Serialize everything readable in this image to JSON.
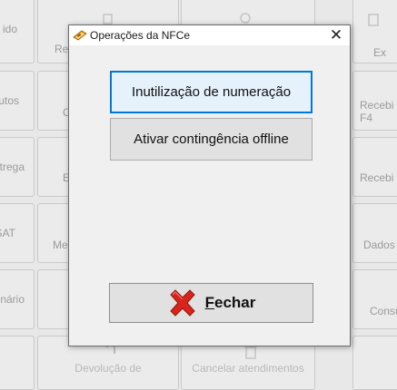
{
  "background": {
    "left_column": [
      "ido",
      "utos",
      "trega",
      "SAT",
      "nário"
    ],
    "col2": [
      "Re",
      "C",
      "E",
      "Me",
      "",
      "Devolução de"
    ],
    "col3": [
      "",
      "",
      "",
      "",
      "",
      "Cancelar atendimentos"
    ],
    "right_column": [
      "Ex",
      "Recebi\nF4",
      "Recebi",
      "Dados",
      "Consu",
      ""
    ]
  },
  "dialog": {
    "title": "Operações da NFCe",
    "close_glyph": "✕",
    "buttons": {
      "inutilizacao": "Inutilização de numeração",
      "contingencia": "Ativar contingência offline",
      "fechar": "Fechar"
    }
  },
  "icons": {
    "title": "nfce-app-icon",
    "close": "close-icon",
    "fechar": "red-x-icon"
  },
  "colors": {
    "focus_border": "#0078d7",
    "red_x": "#d9241c"
  }
}
